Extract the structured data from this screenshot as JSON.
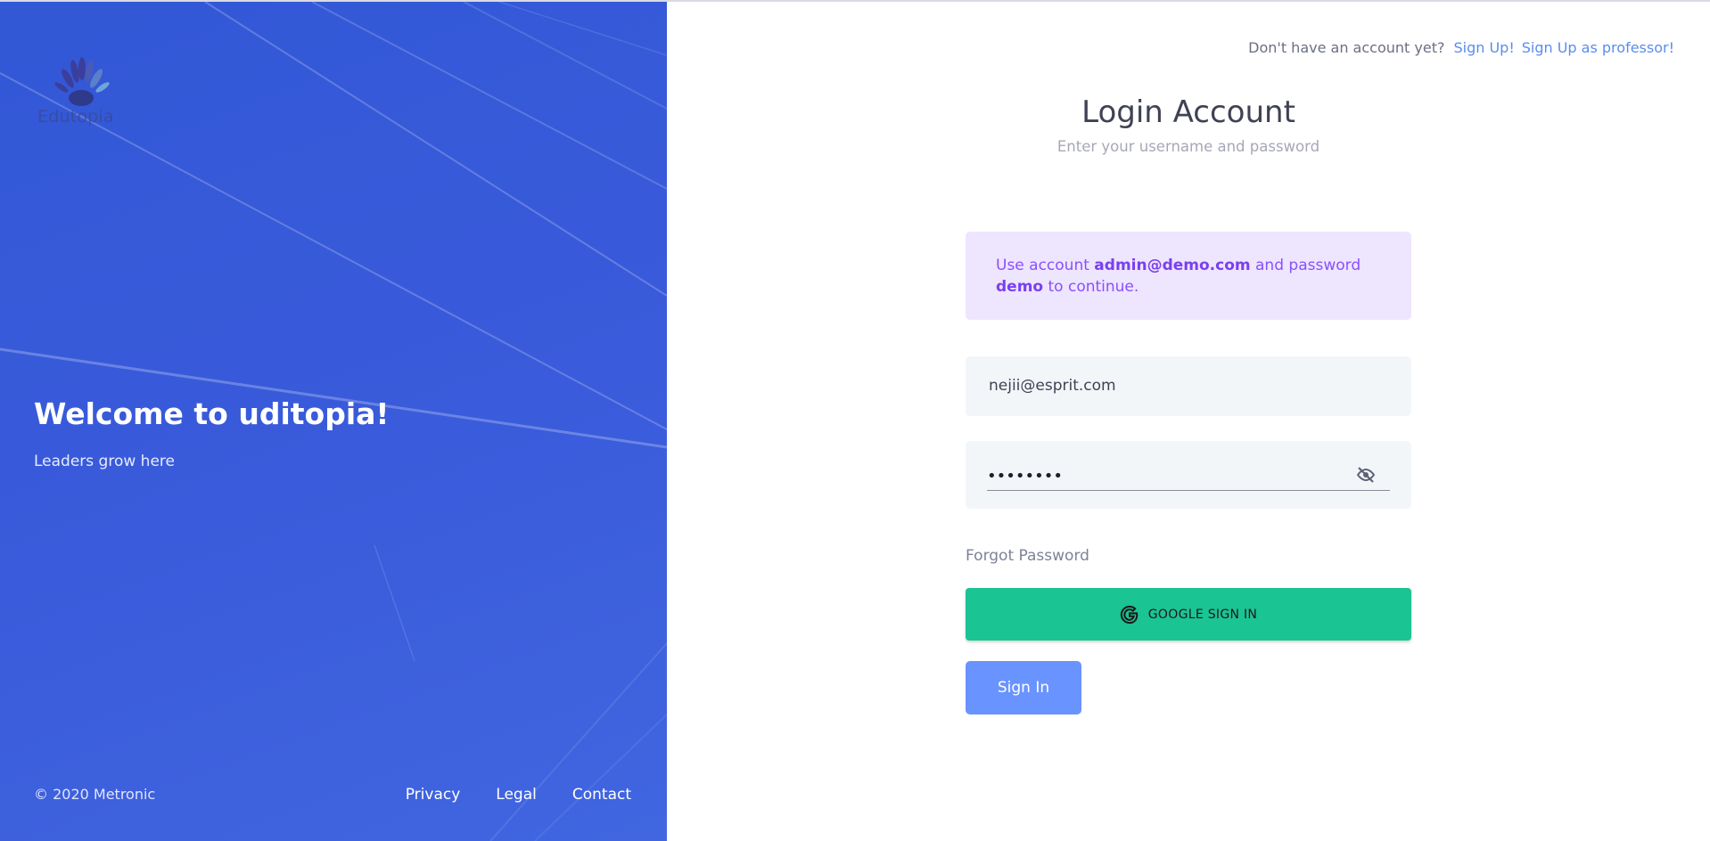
{
  "brand": {
    "logo_text": "Edutopia",
    "welcome_title": "Welcome to uditopia!",
    "welcome_subtitle": "Leaders grow here",
    "copyright": "© 2020 Metronic",
    "footer_links": [
      "Privacy",
      "Legal",
      "Contact"
    ],
    "panel_color": "#3a5bdb"
  },
  "header": {
    "prompt": "Don't have an account yet?",
    "signup_label": "Sign Up!",
    "signup_professor_label": "Sign Up as professor!"
  },
  "form": {
    "title": "Login Account",
    "subtitle": "Enter your username and password",
    "notice": {
      "prefix": "Use account",
      "account": "admin@demo.com",
      "middle": "and password",
      "password": "demo",
      "suffix": "to continue."
    },
    "email_value": "nejii@esprit.com",
    "password_value": "••••••••",
    "password_toggle_icon": "eye-off-icon",
    "forgot_label": "Forgot Password",
    "google_label": "GOOGLE SIGN IN",
    "signin_label": "Sign In"
  },
  "colors": {
    "accent_blue": "#5a8dee",
    "google_green": "#1bc493",
    "signin_blue": "#6993ff",
    "notice_bg": "#eee5ff",
    "notice_text": "#8950fc"
  }
}
